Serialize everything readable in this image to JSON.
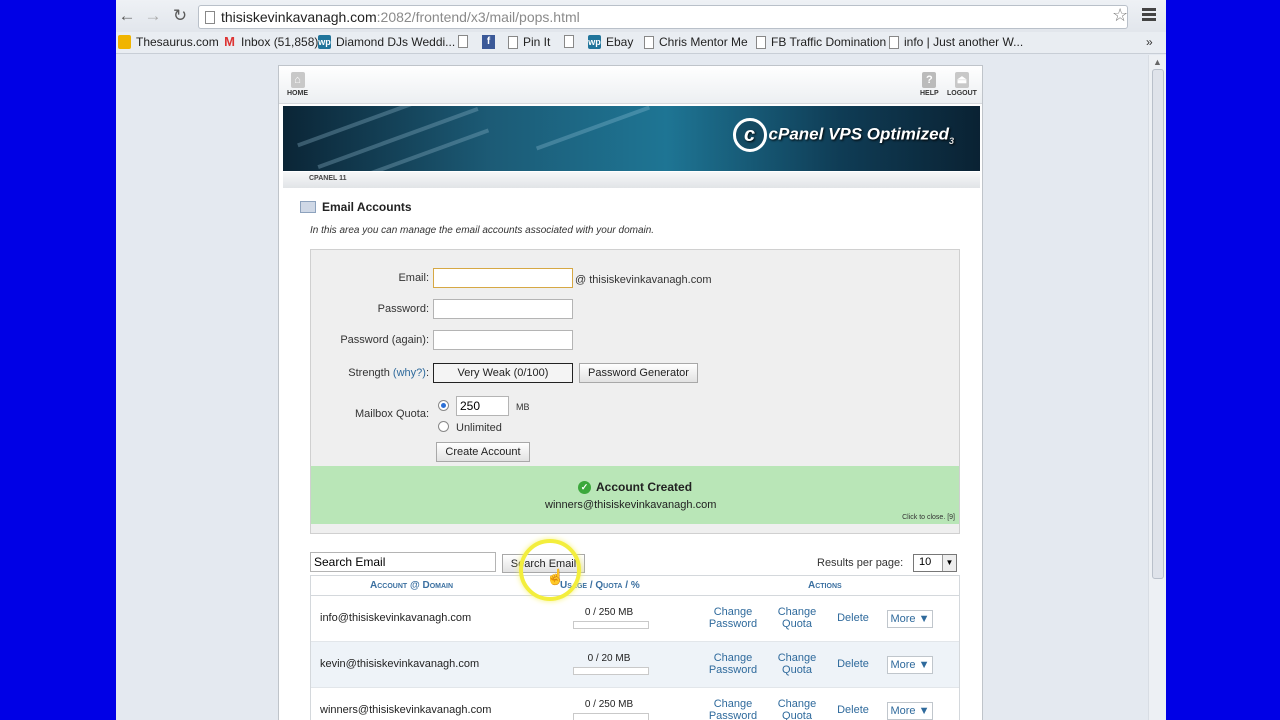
{
  "browser": {
    "url_host": "thisiskevinkavanagh.com",
    "url_path": ":2082/frontend/x3/mail/pops.html",
    "bookmarks": [
      {
        "label": "Thesaurus.com",
        "icon": "thesaurus-icon"
      },
      {
        "label": "Inbox (51,858)",
        "icon": "gmail-icon"
      },
      {
        "label": "Diamond DJs Weddi...",
        "icon": "wordpress-icon"
      },
      {
        "label": "",
        "icon": "page-icon"
      },
      {
        "label": "",
        "icon": "facebook-icon"
      },
      {
        "label": "Pin It",
        "icon": "page-icon"
      },
      {
        "label": "",
        "icon": "page-icon"
      },
      {
        "label": "Ebay",
        "icon": "wordpress-icon"
      },
      {
        "label": "Chris Mentor Me",
        "icon": "page-icon"
      },
      {
        "label": "FB Traffic Domination",
        "icon": "page-icon"
      },
      {
        "label": "info | Just another W...",
        "icon": "page-icon"
      }
    ],
    "more": "»"
  },
  "cpanel": {
    "home_label": "HOME",
    "help_label": "HELP",
    "logout_label": "LOGOUT",
    "logo_text": "cPanel VPS Optimized",
    "logo_sub": "3",
    "version": "CPANEL 11"
  },
  "page": {
    "title": "Email Accounts",
    "description": "In this area you can manage the email accounts associated with your domain."
  },
  "form": {
    "email_label": "Email:",
    "email_value": "",
    "domain": "@ thisiskevinkavanagh.com",
    "password_label": "Password:",
    "password_again_label": "Password (again):",
    "strength_label": "Strength",
    "why_label": "(why?)",
    "strength_colon": ":",
    "strength_value": "Very Weak (0/100)",
    "generator_label": "Password Generator",
    "quota_label": "Mailbox Quota:",
    "quota_value": "250",
    "quota_unit": "MB",
    "unlimited_label": "Unlimited",
    "create_label": "Create Account"
  },
  "status": {
    "title": "Account Created",
    "message": "winners@thisiskevinkavanagh.com",
    "close": "Click to close. [9]"
  },
  "search": {
    "value": "Search Email",
    "button": "Search Email",
    "rpp_label": "Results per page:",
    "rpp_value": "10"
  },
  "table": {
    "headers": {
      "account": "Account @ Domain",
      "usage": "Usage / Quota / %",
      "actions": "Actions"
    },
    "action_labels": {
      "change": "Change",
      "password": "Password",
      "quota": "Quota",
      "delete": "Delete",
      "more": "More ▼"
    },
    "rows": [
      {
        "email": "info@thisiskevinkavanagh.com",
        "usage": "0 / 250 MB",
        "fraction": 0
      },
      {
        "email": "kevin@thisiskevinkavanagh.com",
        "usage": "0 / 20 MB",
        "fraction": 0
      },
      {
        "email": "winners@thisiskevinkavanagh.com",
        "usage": "0 / 250 MB",
        "fraction": 0
      }
    ]
  }
}
